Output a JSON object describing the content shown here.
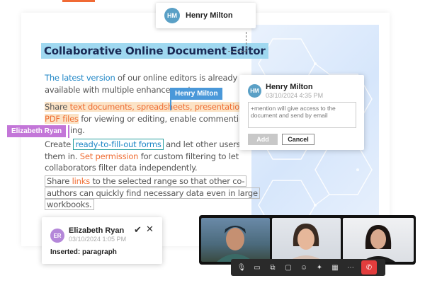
{
  "header_card": {
    "initials": "HM",
    "name": "Henry Milton"
  },
  "document": {
    "title": "Collaborative Online Document Editor",
    "p1": {
      "link": "The latest version",
      "rest1": " of our online editors is already",
      "rest2": "available with multiple enhancements"
    },
    "p2": {
      "part1": "Share ",
      "orange1": "text documents, spreadsheets, presentations,",
      "mid": " and",
      "orange2": "PDF files",
      "rest": " for viewing  or editing, enable commenting or",
      "line4": "ing."
    },
    "p3": {
      "pre": "Create ",
      "box": "ready-to-fill-out forms",
      "post": " and let other users fill",
      "line2a": "them in. ",
      "orange": "Set permission",
      "line2b": " for custom filtering to let",
      "line3": "collaborators filter data independently."
    },
    "p4": {
      "pre": "Share ",
      "link": "links",
      "post": " to the selected range so that other co-",
      "line2": "authors can quickly find necessary data even in large",
      "line3": "workbooks."
    }
  },
  "cursor_tags": {
    "blue": "Henry Milton",
    "purple": "Elizabeth Ryan"
  },
  "comment": {
    "initials": "HM",
    "name": "Henry Milton",
    "date": "03/10/2024  4:35 PM",
    "placeholder": "+mention will give access to the document and send by email",
    "add_label": "Add",
    "cancel_label": "Cancel"
  },
  "insertion": {
    "initials": "ER",
    "name": "Elizabeth Ryan",
    "date": "03/10/2024  1:05 PM",
    "text": "Inserted: paragraph"
  },
  "call_controls": [
    "mic-icon",
    "camera-icon",
    "share-screen-icon",
    "chat-icon",
    "emoji-icon",
    "effects-icon",
    "grid-icon",
    "more-icon",
    "hang-up-icon"
  ],
  "colors": {
    "accent_blue": "#4a98d9",
    "accent_purple": "#c376d8",
    "orange": "#ef6d33",
    "title_bg": "#9fd8f0",
    "hang_up": "#e23d3d"
  }
}
